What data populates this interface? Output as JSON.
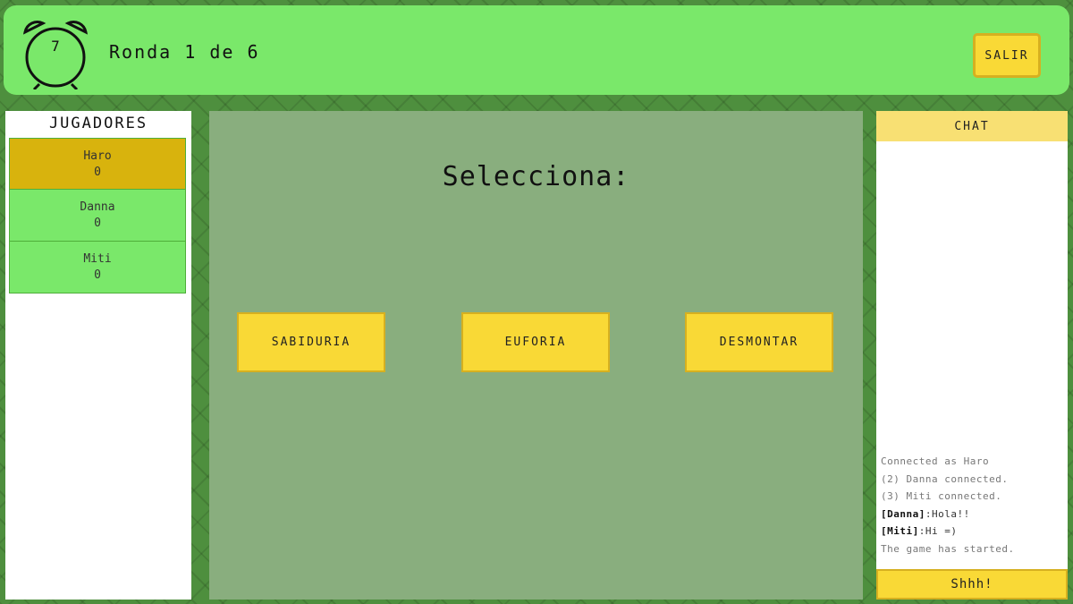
{
  "header": {
    "timer_value": "7",
    "round_label": "Ronda 1 de 6",
    "exit_label": "SALIR"
  },
  "players": {
    "title": "JUGADORES",
    "list": [
      {
        "name": "Haro",
        "score": "0",
        "active": true
      },
      {
        "name": "Danna",
        "score": "0",
        "active": false
      },
      {
        "name": "Miti",
        "score": "0",
        "active": false
      }
    ]
  },
  "main": {
    "prompt": "Selecciona:",
    "options": [
      "SABIDURIA",
      "EUFORIA",
      "DESMONTAR"
    ]
  },
  "chat": {
    "title": "CHAT",
    "log": {
      "line1": "Connected as Haro",
      "line2": "(2) Danna connected.",
      "line3": "(3) Miti connected.",
      "msg1_user": "[Danna]",
      "msg1_text": ":Hola!!",
      "msg2_user": "[Miti]",
      "msg2_text": ":Hi =)",
      "line4": "The game has started."
    },
    "shh_label": "Shhh!"
  },
  "colors": {
    "topbar": "#7ae86a",
    "active_player": "#d8b30d",
    "button": "#f9d936",
    "main_panel": "#89ae7e",
    "chat_header": "#f8e073"
  },
  "icons": {
    "timer": "alarm-clock-icon"
  }
}
